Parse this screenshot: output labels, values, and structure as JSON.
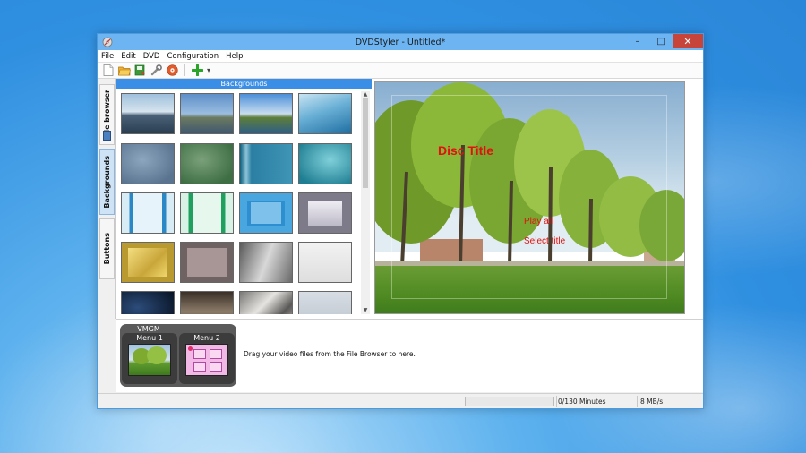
{
  "window": {
    "title": "DVDStyler - Untitled*"
  },
  "window_controls": {
    "minimize": "–",
    "maximize": "□",
    "close": "✕"
  },
  "menu": [
    "File",
    "Edit",
    "DVD",
    "Configuration",
    "Help"
  ],
  "toolbar": {
    "icons": [
      "new-file-icon",
      "open-folder-icon",
      "save-icon",
      "settings-wrench-icon",
      "burn-disc-icon",
      "add-icon"
    ],
    "dropdown": "▾"
  },
  "side_tabs": [
    {
      "label": "File browser",
      "active": false
    },
    {
      "label": "Backgrounds",
      "active": true
    },
    {
      "label": "Buttons",
      "active": false
    }
  ],
  "panel": {
    "title": "Backgrounds"
  },
  "preview": {
    "disc_title": "Disc Title",
    "buttons": [
      "Play all",
      "Select title"
    ]
  },
  "titleset": {
    "vmgm_label": "VMGM",
    "menus": [
      "Menu 1",
      "Menu 2"
    ],
    "hint": "Drag your video files from the File Browser to here."
  },
  "status": {
    "progress": 0,
    "minutes": "0/130 Minutes",
    "rate": "8 MB/s"
  },
  "colors": {
    "accent": "#3a8ee6",
    "title_red": "#e0120e",
    "titlebar": "#6db4f2"
  }
}
